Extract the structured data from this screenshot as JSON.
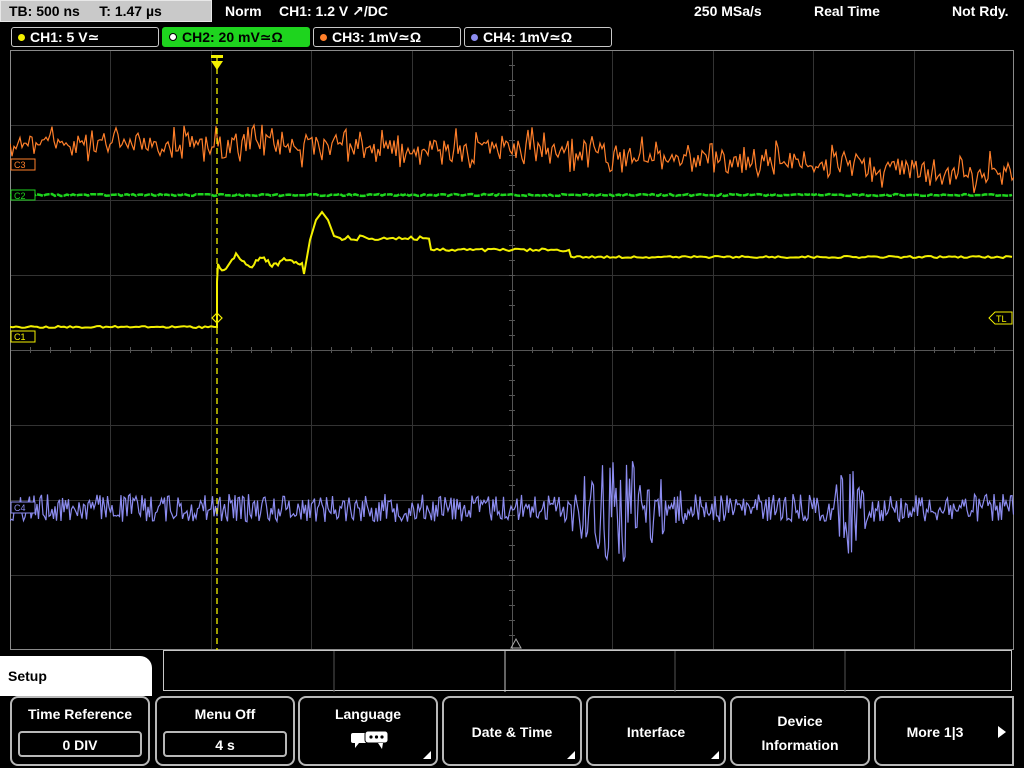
{
  "status": {
    "timebase": "TB: 500 ns",
    "trigger_time": "T: 1.47 µs",
    "mode": "Norm",
    "trigger_info": "CH1: 1.2 V ↗/DC",
    "sample_rate": "250 MSa/s",
    "acq_mode": "Real Time",
    "ready_state": "Not Rdy."
  },
  "channels": [
    {
      "label": "CH1: 5 V≃",
      "color": "#f3f000",
      "active": false
    },
    {
      "label": "CH2: 20 mV≃Ω",
      "color": "#1ed41e",
      "active": true
    },
    {
      "label": "CH3: 1mV≃Ω",
      "color": "#ff7f2a",
      "active": false
    },
    {
      "label": "CH4: 1mV≃Ω",
      "color": "#8c8cf0",
      "active": false
    }
  ],
  "markers": {
    "trigger_level": "TL",
    "c3": "C3",
    "c2": "C2",
    "c1": "C1",
    "c4": "C4"
  },
  "menu": {
    "title": "Setup",
    "keys": [
      {
        "title": "Time Reference",
        "value": "0 DIV"
      },
      {
        "title": "Menu Off",
        "value": "4 s"
      },
      {
        "title": "Language",
        "icon": "speech-bubbles-icon"
      },
      {
        "title": "Date & Time"
      },
      {
        "title": "Interface"
      },
      {
        "title": "Device",
        "title2": "Information"
      },
      {
        "title": "More 1|3"
      }
    ]
  }
}
